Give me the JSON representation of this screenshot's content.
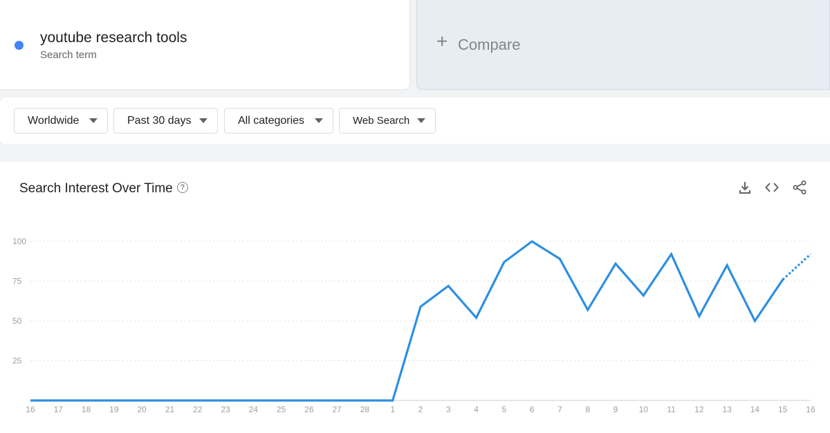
{
  "search_term": {
    "label": "youtube research tools",
    "sublabel": "Search term",
    "color": "#4285f4"
  },
  "compare": {
    "label": "Compare"
  },
  "filters": [
    {
      "label": "Worldwide"
    },
    {
      "label": "Past 30 days"
    },
    {
      "label": "All categories"
    },
    {
      "label": "Web Search"
    }
  ],
  "chart_card": {
    "title": "Search Interest Over Time",
    "tools": [
      "download-icon",
      "embed-code-icon",
      "share-icon"
    ]
  },
  "chart_data": {
    "type": "line",
    "title": "Search Interest Over Time",
    "x": [
      "16",
      "17",
      "18",
      "19",
      "20",
      "21",
      "22",
      "23",
      "24",
      "25",
      "26",
      "27",
      "28",
      "1",
      "2",
      "3",
      "4",
      "5",
      "6",
      "7",
      "8",
      "9",
      "10",
      "11",
      "12",
      "13",
      "14",
      "15",
      "16"
    ],
    "series": [
      {
        "values": [
          0,
          0,
          0,
          0,
          0,
          0,
          0,
          0,
          0,
          0,
          0,
          0,
          0,
          0,
          59,
          72,
          52,
          87,
          100,
          89,
          57,
          86,
          66,
          92,
          53,
          85,
          50,
          76,
          92
        ],
        "partial_last": true,
        "color": "#2d8fe0"
      }
    ],
    "yticks": [
      25,
      50,
      75,
      100
    ],
    "ylim": [
      0,
      100
    ],
    "grid": true,
    "legend": "none"
  }
}
